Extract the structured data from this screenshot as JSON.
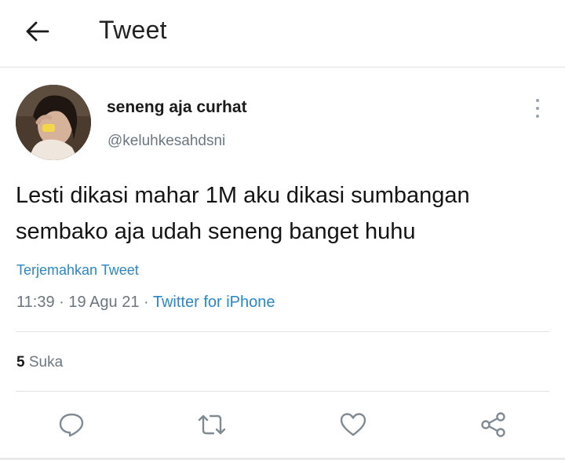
{
  "header": {
    "back_icon": "arrow-left-icon",
    "title": "Tweet"
  },
  "author": {
    "name": "seneng aja curhat",
    "handle": "@keluhkesahdsni"
  },
  "tweet": {
    "lines": [
      "Lesti dikasi mahar 1M aku dikasi sumbangan",
      "sembako aja udah seneng banget huhu"
    ],
    "translate_label": "Terjemahkan Tweet",
    "time": "11:39",
    "date": "19 Agu 21",
    "separator": " · ",
    "source": "Twitter for iPhone"
  },
  "stats": {
    "likes_count": "5",
    "likes_label": "Suka"
  },
  "actions": [
    {
      "name": "reply",
      "icon": "reply-bubble-icon"
    },
    {
      "name": "retweet",
      "icon": "retweet-icon"
    },
    {
      "name": "like",
      "icon": "heart-icon"
    },
    {
      "name": "share",
      "icon": "share-icon"
    }
  ],
  "colors": {
    "link": "#2b87c7",
    "muted": "#6b7780",
    "divider": "#e1e4e6",
    "icon": "#7f8a92"
  }
}
